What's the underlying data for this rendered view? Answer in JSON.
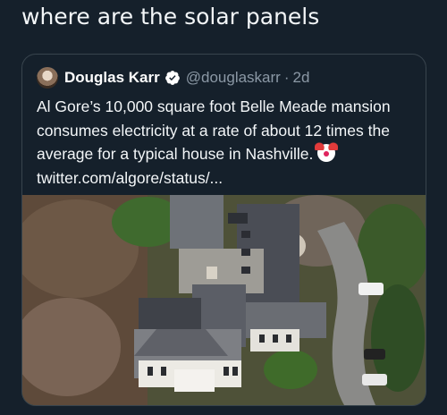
{
  "post": {
    "text": "where are the solar panels"
  },
  "quoted_tweet": {
    "display_name": "Douglas Karr",
    "handle": "@douglaskarr",
    "separator": "·",
    "time": "2d",
    "body_text": "Al Gore’s 10,000 square foot Belle Meade mansion consumes electricity at a rate of about 12 times the average for a typical house in Nashville.",
    "link_text": "twitter.com/algore/status/...",
    "icons": {
      "verified": "verified-badge-icon",
      "emoji": "clown-face-icon"
    },
    "colors": {
      "verified": "#1d9bf0"
    }
  },
  "photo": {
    "subject": "aerial-photo-mansion"
  }
}
